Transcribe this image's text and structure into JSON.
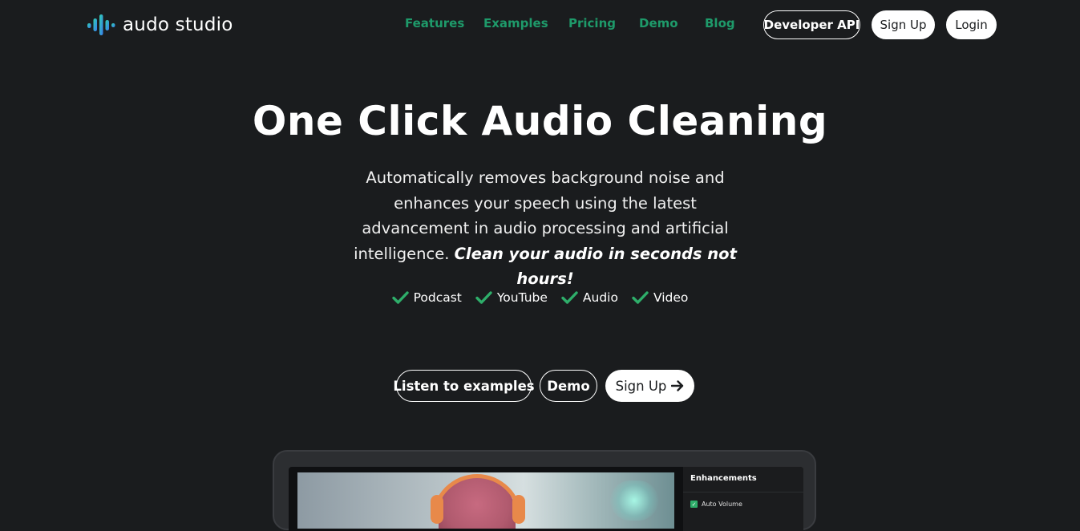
{
  "brand": {
    "name": "audo studio",
    "colors": {
      "accent": "#1e9a6a",
      "check": "#2eae6a",
      "background": "#1a1c1e",
      "logo_gradient": [
        "#2fd2b0",
        "#3a7bf0"
      ]
    }
  },
  "nav": {
    "links": [
      "Features",
      "Examples",
      "Pricing",
      "Demo",
      "Blog"
    ],
    "developer_api": "Developer API",
    "sign_up": "Sign Up",
    "login": "Login"
  },
  "hero": {
    "title": "One Click Audio Cleaning",
    "description": "Automatically removes background noise and enhances your speech using the latest advancement in audio processing and artificial intelligence.",
    "description_emphasis": "Clean your audio in seconds not hours!",
    "use_cases": [
      "Podcast",
      "YouTube",
      "Audio",
      "Video"
    ]
  },
  "cta": {
    "listen": "Listen to examples",
    "demo": "Demo",
    "sign_up": "Sign Up",
    "sign_up_icon": "arrow-right-icon"
  },
  "preview": {
    "panel_title": "Enhancements",
    "option_label": "Auto Volume",
    "option_checked": true
  }
}
